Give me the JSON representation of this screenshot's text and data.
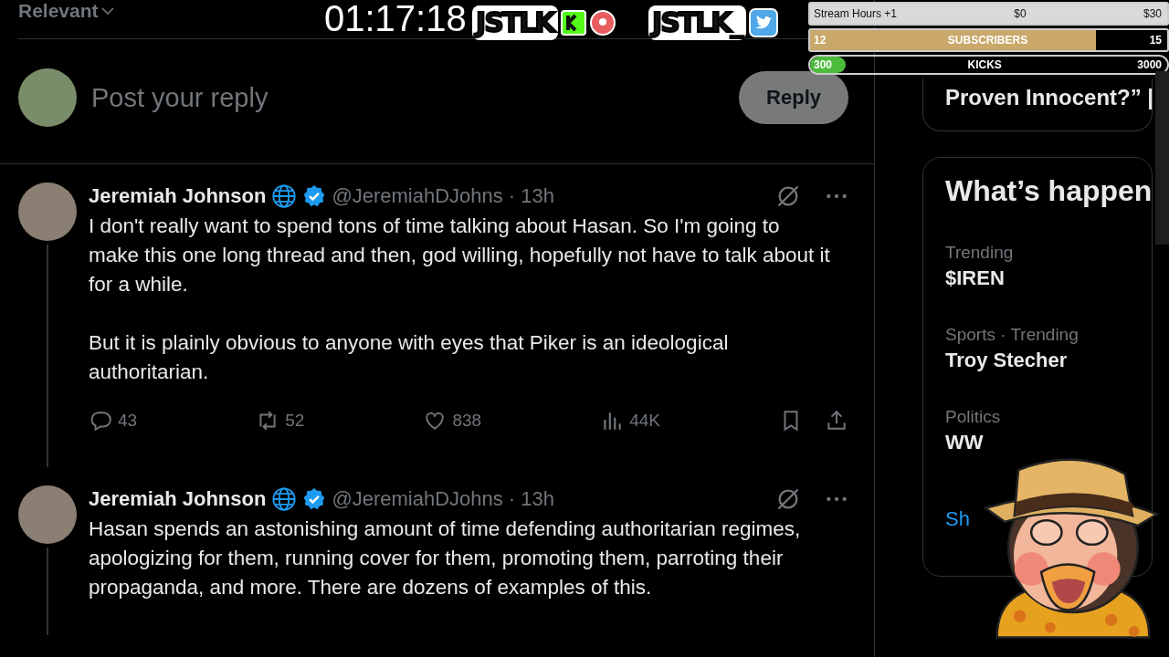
{
  "sort": {
    "label": "Relevant"
  },
  "reply_box": {
    "placeholder": "Post your reply",
    "button": "Reply"
  },
  "tweets": [
    {
      "name": "Jeremiah Johnson",
      "handle": "@JeremiahDJohns",
      "time": "· 13h",
      "verified": true,
      "paragraphs": [
        "I don't really want to spend tons of time talking about Hasan. So I'm going to make this one long thread and then, god willing, hopefully not have to talk about it for a while.",
        "But it is plainly obvious to anyone with eyes that Piker is an ideological authoritarian."
      ],
      "stats": {
        "replies": "43",
        "reposts": "52",
        "likes": "838",
        "views": "44K"
      }
    },
    {
      "name": "Jeremiah Johnson",
      "handle": "@JeremiahDJohns",
      "time": "· 13h",
      "verified": true,
      "paragraphs": [
        "Hasan spends an astonishing amount of time defending authoritarian regimes, apologizing for them, running cover for them, promoting them, parroting their propaganda, and more. There are dozens of examples of this."
      ]
    }
  ],
  "sidebar": {
    "event_card": {
      "lines": [
        "Proven Innocent?” |"
      ]
    },
    "trends": {
      "title": "What’s happen",
      "items": [
        {
          "category": "Trending",
          "name": "$IREN"
        },
        {
          "category": "Sports · Trending",
          "name": "Troy Stecher"
        },
        {
          "category": "Politics",
          "name": "WW"
        }
      ],
      "show_more": "Sh"
    }
  },
  "overlay": {
    "timer": "01:17:18",
    "logos": [
      {
        "text": "JSTLK",
        "kind": "kick"
      },
      {
        "text": "JSTLK_",
        "kind": "twitter"
      }
    ],
    "goals": [
      {
        "kind": "light",
        "label": "Stream Hours +1",
        "start": "$0",
        "end": "$30",
        "level": 0
      },
      {
        "kind": "gold",
        "label": "SUBSCRIBERS",
        "start": "12",
        "end": "15",
        "level": 0.8
      },
      {
        "kind": "green",
        "label": "KICKS",
        "start": "300",
        "end": "3000",
        "level": 0.1
      }
    ]
  }
}
